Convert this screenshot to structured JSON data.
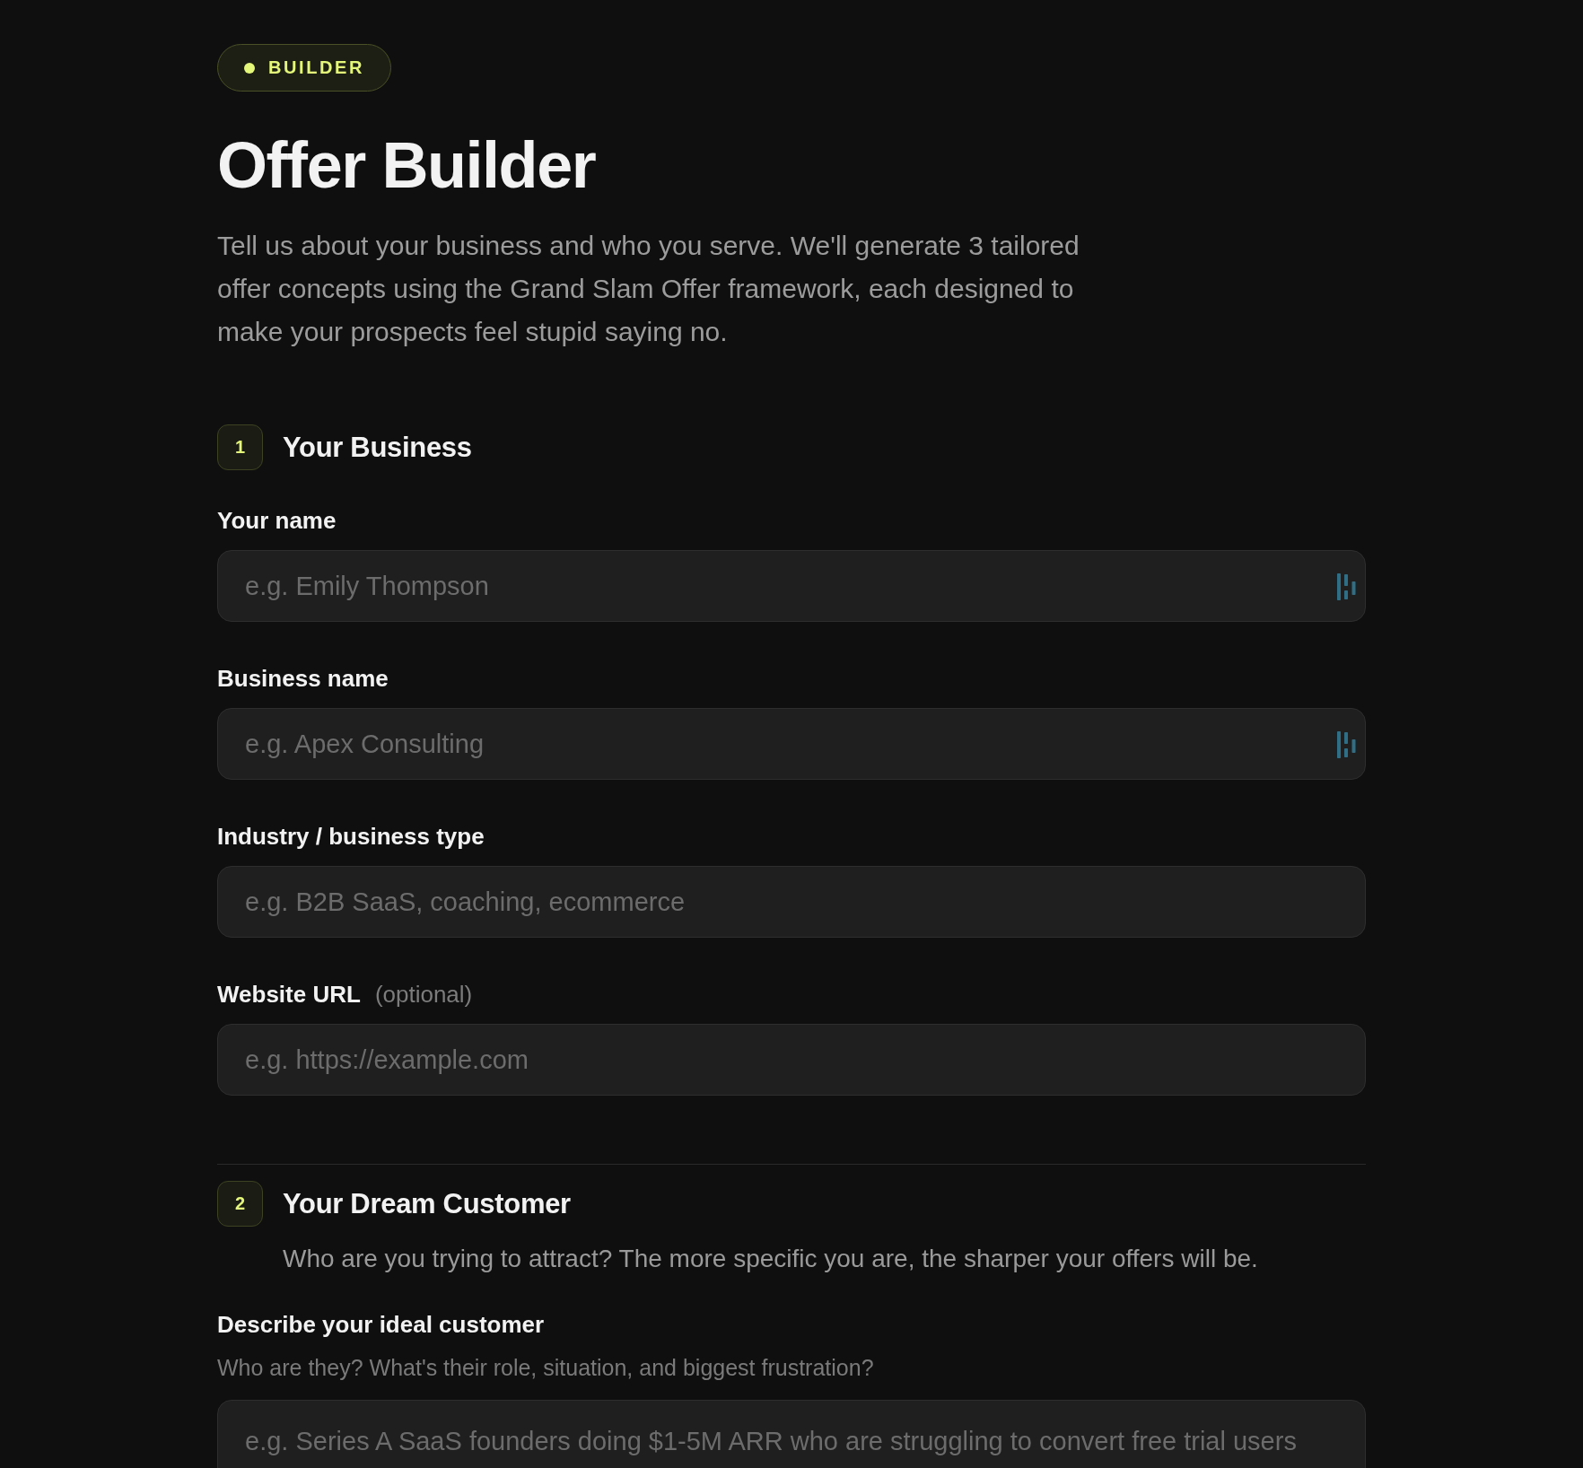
{
  "badge": {
    "label": "BUILDER"
  },
  "title": "Offer Builder",
  "intro": "Tell us about your business and who you serve. We'll generate 3 tailored offer concepts using the Grand Slam Offer framework, each designed to make your prospects feel stupid saying no.",
  "sections": [
    {
      "number": "1",
      "title": "Your Business",
      "fields": [
        {
          "kind": "input",
          "label": "Your name",
          "placeholder": "e.g. Emily Thompson",
          "autofill_icon": true
        },
        {
          "kind": "input",
          "label": "Business name",
          "placeholder": "e.g. Apex Consulting",
          "autofill_icon": true
        },
        {
          "kind": "input",
          "label": "Industry / business type",
          "placeholder": "e.g. B2B SaaS, coaching, ecommerce",
          "autofill_icon": false
        },
        {
          "kind": "input",
          "label": "Website URL",
          "note": "(optional)",
          "placeholder": "e.g. https://example.com",
          "autofill_icon": false
        }
      ]
    },
    {
      "number": "2",
      "title": "Your Dream Customer",
      "subtitle": "Who are you trying to attract? The more specific you are, the sharper your offers will be.",
      "fields": [
        {
          "kind": "textarea",
          "label": "Describe your ideal customer",
          "hint": "Who are they? What's their role, situation, and biggest frustration?",
          "placeholder": "e.g. Series A SaaS founders doing $1-5M ARR who are struggling to convert free trial users",
          "autofill_icon": false
        }
      ]
    }
  ]
}
